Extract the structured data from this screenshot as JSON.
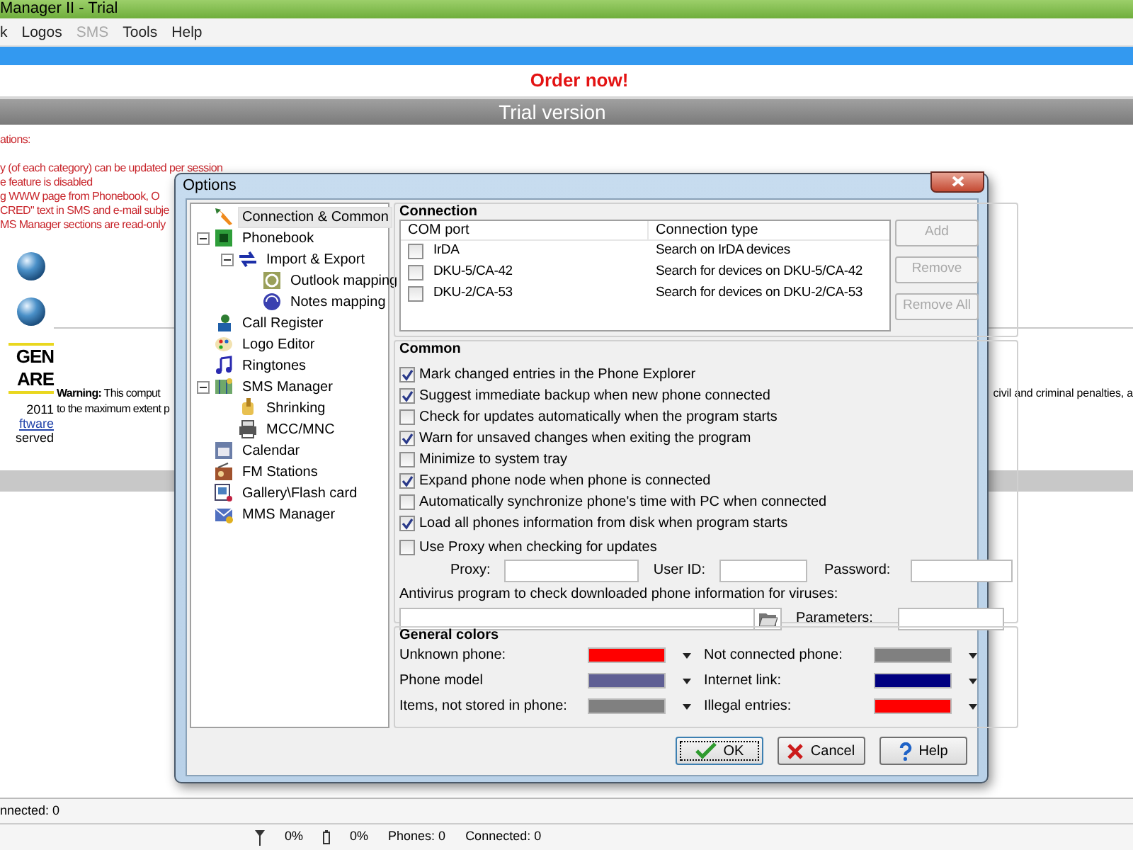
{
  "app": {
    "title": "Manager II - Trial",
    "menu": [
      {
        "label": "k",
        "disabled": false
      },
      {
        "label": "Logos",
        "disabled": false
      },
      {
        "label": "SMS",
        "disabled": true
      },
      {
        "label": "Tools",
        "disabled": false
      },
      {
        "label": "Help",
        "disabled": false
      }
    ],
    "order_link": "Order now!",
    "banner": "Trial version",
    "limitations": [
      "ations:",
      "y (of each category) can be updated per session",
      "e feature is disabled",
      "g WWW page from Phonebook, O",
      "CRED\" text in SMS and e-mail subje",
      "MS Manager sections are read-only"
    ],
    "logo": [
      "GEN",
      "ARE"
    ],
    "copyright": {
      "year": "2011",
      "link": "ftware",
      "rights": "served"
    },
    "warning": {
      "lines": [
        "**Warning:** This comput",
        "to the maximum extent p"
      ],
      "right": "civil and criminal penalties, a"
    },
    "status_bar": {
      "connected": "nnected: 0",
      "signal": "0%",
      "battery": "0%",
      "phones": "Phones: 0",
      "connections": "Connected: 0"
    }
  },
  "dialog": {
    "title": "Options",
    "tree": [
      {
        "label": "Connection & Common",
        "selected": true
      },
      {
        "label": "Phonebook",
        "selected": false,
        "expanded": true,
        "children": [
          {
            "label": "Import & Export",
            "selected": false,
            "expanded": true,
            "children": [
              {
                "label": "Outlook mapping",
                "selected": false
              },
              {
                "label": "Notes mapping",
                "selected": false
              }
            ]
          }
        ]
      },
      {
        "label": "Call Register",
        "selected": false
      },
      {
        "label": "Logo Editor",
        "selected": false
      },
      {
        "label": "Ringtones",
        "selected": false
      },
      {
        "label": "SMS Manager",
        "selected": false,
        "expanded": true,
        "children": [
          {
            "label": "Shrinking",
            "selected": false
          },
          {
            "label": "MCC/MNC",
            "selected": false
          }
        ]
      },
      {
        "label": "Calendar",
        "selected": false
      },
      {
        "label": "FM Stations",
        "selected": false
      },
      {
        "label": "Gallery\\Flash card",
        "selected": false
      },
      {
        "label": "MMS Manager",
        "selected": false
      }
    ],
    "connection": {
      "title": "Connection",
      "columns": [
        "COM port",
        "Connection type"
      ],
      "rows": [
        {
          "port": "IrDA",
          "type": "Search on IrDA devices",
          "checked": false
        },
        {
          "port": "DKU-5/CA-42",
          "type": "Search for devices on DKU-5/CA-42",
          "checked": false
        },
        {
          "port": "DKU-2/CA-53",
          "type": "Search for devices on DKU-2/CA-53",
          "checked": false
        }
      ],
      "buttons": [
        {
          "label": "Add",
          "disabled": true
        },
        {
          "label": "Remove",
          "disabled": true
        },
        {
          "label": "Remove All",
          "disabled": true
        }
      ]
    },
    "common": {
      "title": "Common",
      "options": [
        {
          "label": "Mark changed entries in the Phone Explorer",
          "checked": true
        },
        {
          "label": "Suggest immediate backup when new phone connected",
          "checked": true
        },
        {
          "label": "Check for updates automatically when the program starts",
          "checked": false
        },
        {
          "label": "Warn for unsaved changes when exiting the program",
          "checked": true
        },
        {
          "label": "Minimize to system tray",
          "checked": false
        },
        {
          "label": "Expand phone node when phone is connected",
          "checked": true
        },
        {
          "label": "Automatically synchronize phone's time with PC when connected",
          "checked": false
        },
        {
          "label": "Load all phones information from disk when program starts",
          "checked": true
        }
      ],
      "proxy_option": {
        "label": "Use Proxy when checking for updates",
        "checked": false
      },
      "proxy_fields": [
        "Proxy:",
        "User ID:",
        "Password:"
      ],
      "antivirus_label": "Antivirus program to check downloaded phone information for viruses:",
      "parameters_label": "Parameters:"
    },
    "colors": {
      "title": "General colors",
      "items": [
        {
          "label": "Unknown phone:",
          "color": "#ff0000"
        },
        {
          "label": "Not connected phone:",
          "color": "#808080"
        },
        {
          "label": "Phone model",
          "color": "#5f5f94"
        },
        {
          "label": "Internet link:",
          "color": "#000080"
        },
        {
          "label": "Items, not stored in phone:",
          "color": "#808080"
        },
        {
          "label": "Illegal entries:",
          "color": "#ff0000"
        }
      ]
    },
    "buttons": [
      {
        "kind": "ok",
        "label": "OK",
        "focused": true
      },
      {
        "kind": "cancel",
        "label": "Cancel",
        "focused": false
      },
      {
        "kind": "help",
        "label": "Help",
        "focused": false
      }
    ]
  }
}
